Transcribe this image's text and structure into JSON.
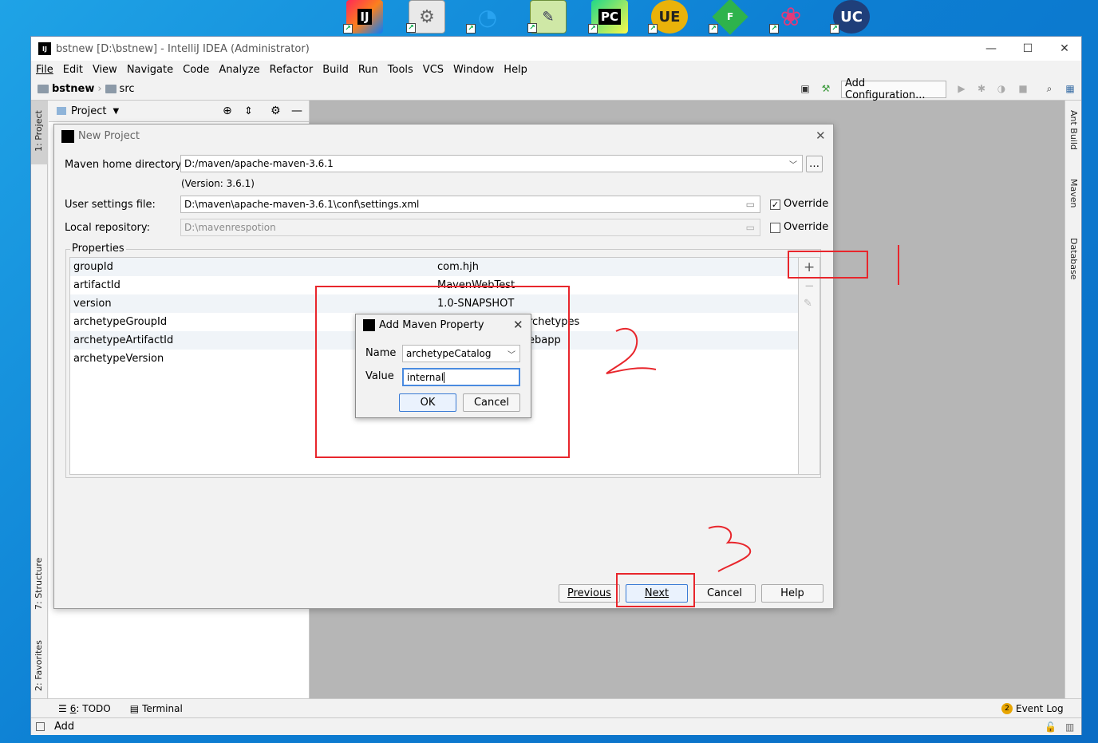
{
  "taskbar": {
    "icons": [
      {
        "name": "intellij-icon",
        "label": "IJ"
      },
      {
        "name": "settings-icon",
        "label": ""
      },
      {
        "name": "network-tool-icon",
        "label": ""
      },
      {
        "name": "notepad-icon",
        "label": ""
      },
      {
        "name": "pycharm-icon",
        "label": "PC"
      },
      {
        "name": "ultraedit-icon",
        "label": "UE"
      },
      {
        "name": "f-app-icon",
        "label": "F"
      },
      {
        "name": "color-app-icon",
        "label": ""
      },
      {
        "name": "ultracompare-icon",
        "label": "UC"
      }
    ]
  },
  "window": {
    "title": "bstnew [D:\\bstnew] - IntelliJ IDEA (Administrator)",
    "app_icon": "IJ"
  },
  "menu": [
    "File",
    "Edit",
    "View",
    "Navigate",
    "Code",
    "Analyze",
    "Refactor",
    "Build",
    "Run",
    "Tools",
    "VCS",
    "Window",
    "Help"
  ],
  "navbar": {
    "project": "bstnew",
    "folder": "src",
    "add_configuration": "Add Configuration..."
  },
  "left_tools": {
    "project": "1: Project",
    "structure": "7: Structure",
    "favorites": "2: Favorites"
  },
  "right_tools": {
    "ant": "Ant Build",
    "maven": "Maven",
    "database": "Database"
  },
  "project_panel": {
    "title": "Project"
  },
  "new_project": {
    "title": "New Project",
    "maven_home_label": "Maven home directory:",
    "maven_home_value": "D:/maven/apache-maven-3.6.1",
    "version": "(Version: 3.6.1)",
    "user_settings_label": "User settings file:",
    "user_settings_value": "D:\\maven\\apache-maven-3.6.1\\conf\\settings.xml",
    "local_repo_label": "Local repository:",
    "local_repo_value": "D:\\mavenrespotion",
    "override_label": "Override",
    "properties_label": "Properties",
    "properties": [
      {
        "key": "groupId",
        "value": "com.hjh"
      },
      {
        "key": "artifactId",
        "value": "MavenWebTest"
      },
      {
        "key": "version",
        "value": "1.0-SNAPSHOT"
      },
      {
        "key": "archetypeGroupId",
        "value": "rchetypes"
      },
      {
        "key": "archetypeArtifactId",
        "value": "ebapp"
      },
      {
        "key": "archetypeVersion",
        "value": ""
      }
    ],
    "buttons": {
      "previous": "Previous",
      "next": "Next",
      "cancel": "Cancel",
      "help": "Help"
    }
  },
  "add_property": {
    "title": "Add Maven Property",
    "name_label": "Name",
    "name_value": "archetypeCatalog",
    "value_label": "Value",
    "value_value": "internal",
    "ok": "OK",
    "cancel": "Cancel"
  },
  "bottom_bar": {
    "todo_prefix": "6",
    "todo": ": TODO",
    "terminal": "Terminal",
    "event_log_count": 2,
    "event_log": "Event Log"
  },
  "status": {
    "text": "Add"
  },
  "colors": {
    "annotation_red": "#e8262c",
    "desktop_blue": "#0d7fd3"
  }
}
